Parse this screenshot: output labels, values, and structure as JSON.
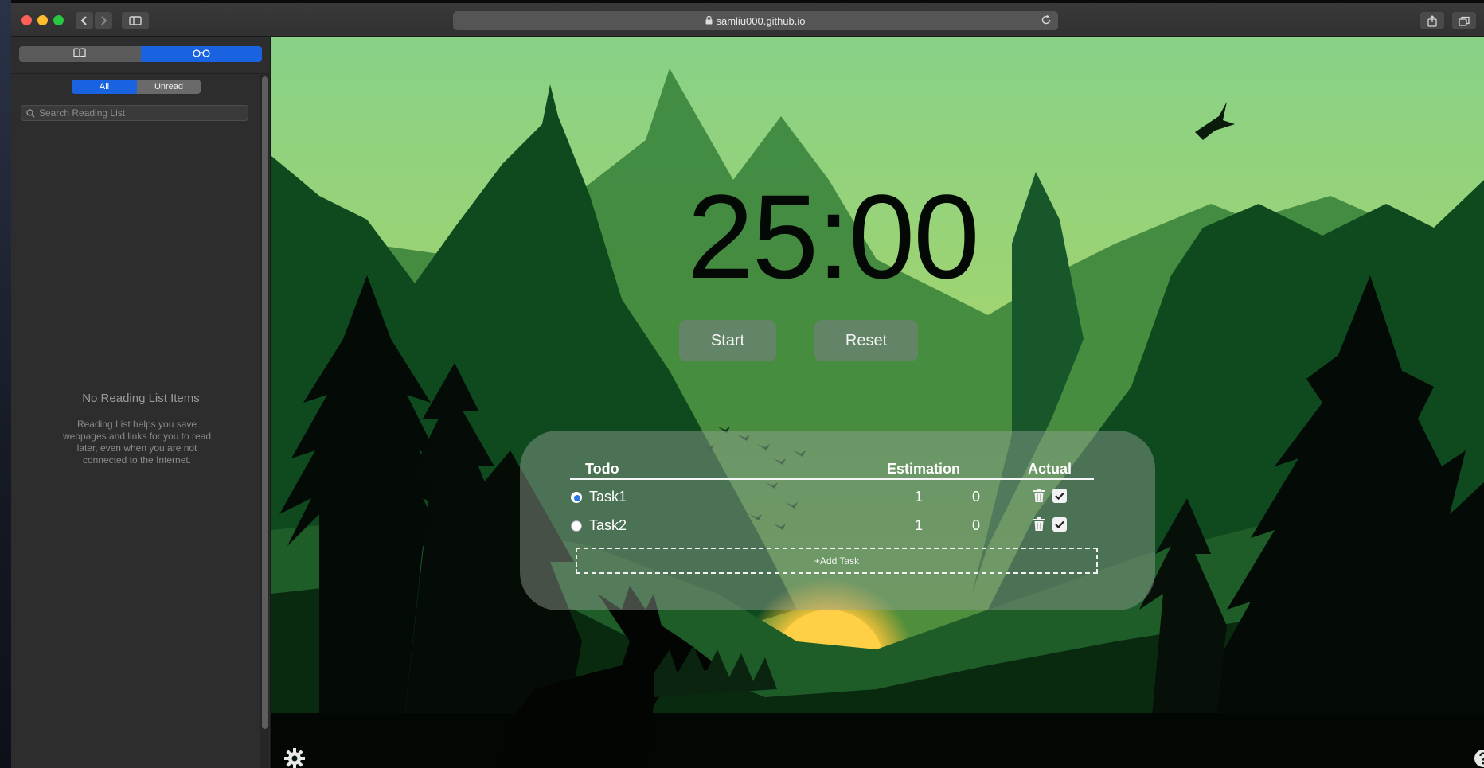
{
  "browser": {
    "url": "samliu000.github.io",
    "icons": {
      "back": "chevron-left-icon",
      "forward": "chevron-right-icon",
      "sidebar": "sidebar-icon",
      "share": "share-icon",
      "tabs": "tabs-icon",
      "lock": "lock-icon",
      "reload": "reload-icon"
    }
  },
  "sidebar": {
    "segments": [
      "bookmarks-icon",
      "reading-list-icon"
    ],
    "active_segment": "reading-list",
    "filters": {
      "all": "All",
      "unread": "Unread",
      "active": "All"
    },
    "search_placeholder": "Search Reading List",
    "empty_title": "No Reading List Items",
    "empty_description": "Reading List helps you save webpages and links for you to read later, even when you are not connected to the Internet."
  },
  "app": {
    "timer": "25:00",
    "start_label": "Start",
    "reset_label": "Reset",
    "todo": {
      "headers": {
        "todo": "Todo",
        "estimation": "Estimation",
        "actual": "Actual"
      },
      "tasks": [
        {
          "name": "Task1",
          "estimation": "1",
          "actual": "0",
          "selected": true
        },
        {
          "name": "Task2",
          "estimation": "1",
          "actual": "0",
          "selected": false
        }
      ],
      "add_label": "+Add Task"
    },
    "colors": {
      "accent_blue": "#1a63e0",
      "sky_top": "#8bd28a",
      "sky_bottom": "#c4dd64",
      "sun": "#ffc93c"
    }
  }
}
